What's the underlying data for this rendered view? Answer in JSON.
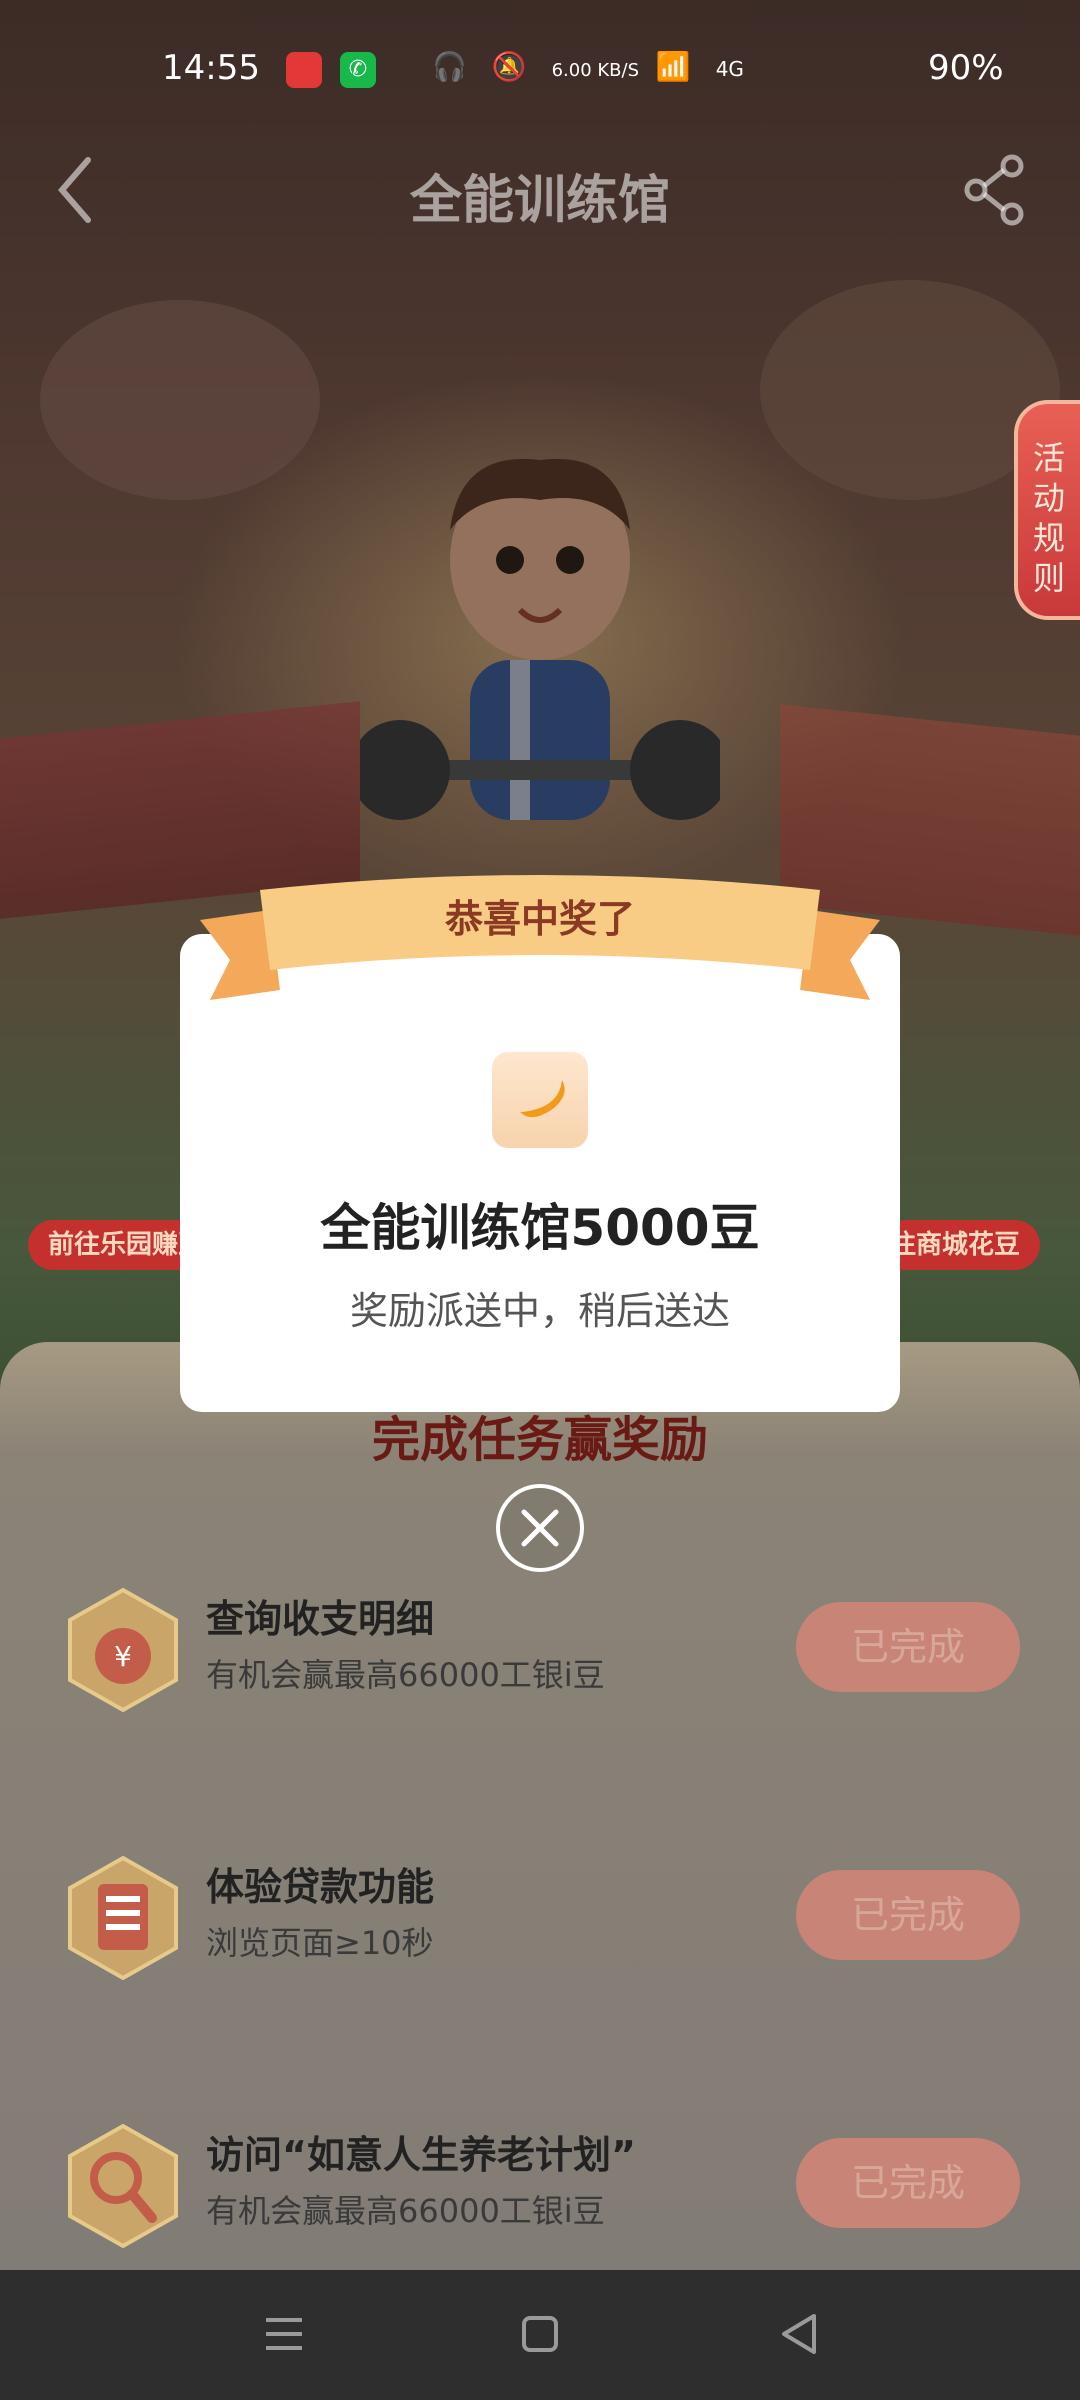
{
  "status_bar": {
    "time": "14:55",
    "net_speed": "6.00 KB/S",
    "network": "4G",
    "battery": "90%"
  },
  "header": {
    "title": "全能训练馆"
  },
  "side_tab": {
    "label": "活动规则"
  },
  "shortcuts": {
    "left": "前往乐园赚豆",
    "right": "往商城花豆"
  },
  "dialog": {
    "ribbon": "恭喜中奖了",
    "prize_name": "全能训练馆5000豆",
    "prize_sub": "奖励派送中，稍后送达",
    "icon": "bean-icon"
  },
  "tasks": {
    "section_title": "完成任务赢奖励",
    "items": [
      {
        "name": "查询收支明细",
        "desc": "有机会赢最高66000工银i豆",
        "button": "已完成",
        "icon": "money-bag-icon"
      },
      {
        "name": "体验贷款功能",
        "desc": "浏览页面≥10秒",
        "button": "已完成",
        "icon": "clipboard-icon"
      },
      {
        "name": "访问“如意人生养老计划”",
        "desc": "有机会赢最高66000工银i豆",
        "button": "已完成",
        "icon": "magnifier-icon"
      }
    ]
  },
  "colors": {
    "accent": "#c3302d",
    "ribbon": "#f7c27a",
    "done_button": "#c88577"
  }
}
